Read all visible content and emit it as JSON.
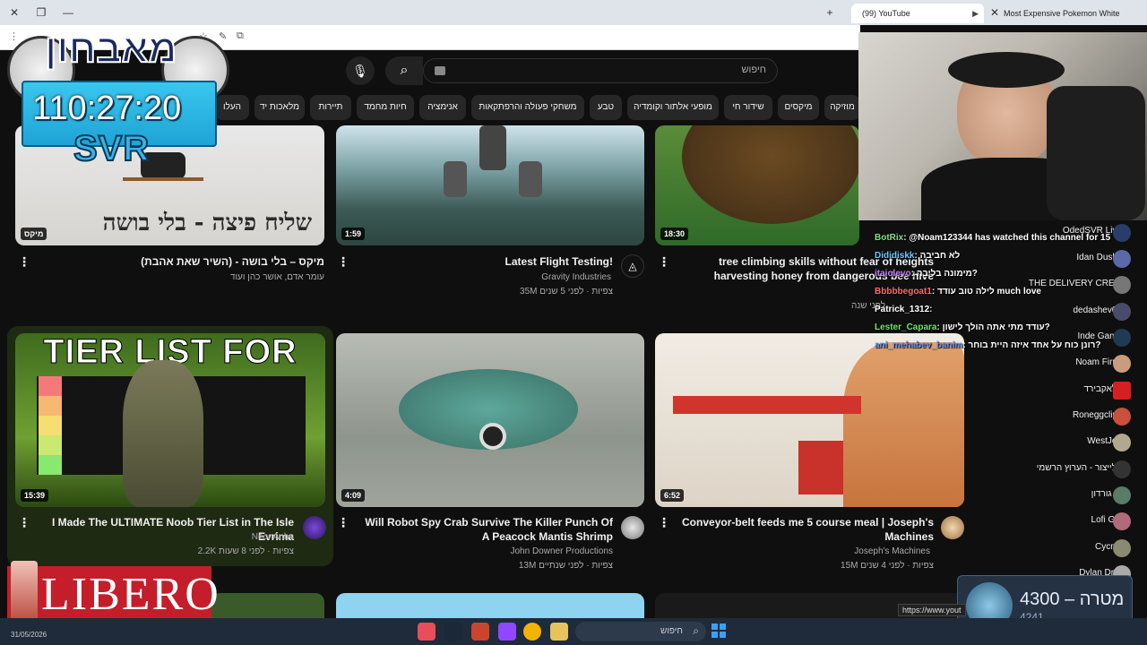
{
  "browser": {
    "tabs": [
      {
        "label": "(99) YouTube",
        "active": true
      },
      {
        "label": "Most Expensive Pokemon White",
        "active": false
      }
    ],
    "new_tab": "+",
    "close_tab": "✕"
  },
  "youtube": {
    "search_placeholder": "חיפוש",
    "chips": [
      "מוזיקה",
      "מיקסים",
      "שידור חי",
      "מופעי אלתור וקומדיה",
      "טבע",
      "משחקי פעולה והרפתקאות",
      "אנימציה",
      "חיות מחמד",
      "תיירות",
      "מלאכות יד",
      "העלו"
    ],
    "videos": [
      {
        "title": "מיקס – בלי בושה - (השיר שאת אהבת)",
        "channel": "עומר אדם, אושר כהן ועוד",
        "meta": "",
        "duration": "מיקס",
        "thumb_text": "שליח פיצה - בלי בושה"
      },
      {
        "title": "Latest Flight Testing!",
        "channel": "Gravity Industries",
        "meta": "35M צפיות · לפני 5 שנים",
        "duration": "1:59"
      },
      {
        "title": "tree climbing skills without fear of heights harvesting honey from dangerous bee hive",
        "channel": "",
        "meta": "לפני שנה",
        "duration": "18:30"
      },
      {
        "title": "I Made The ULTIMATE Noob Tier List in The Isle Evrima",
        "channel": "NeonAnbu",
        "meta": "2.2K צפיות · לפני 8 שעות",
        "duration": "15:39",
        "thumb_text": "TIER LIST FOR NOOBS"
      },
      {
        "title": "Will Robot Spy Crab Survive The Killer Punch Of A Peacock Mantis Shrimp",
        "channel": "John Downer Productions",
        "meta": "13M צפיות · לפני שנתיים",
        "duration": "4:09"
      },
      {
        "title": "Conveyor-belt feeds me 5 course meal | Joseph's Machines",
        "channel": "Joseph's Machines",
        "meta": "15M צפיות · לפני 4 שנים",
        "duration": "6:52"
      }
    ]
  },
  "stream_overlay": {
    "logo": "מאבחון",
    "timer": "110:27:20",
    "svr": "SVR",
    "sponsor": "LIBERO",
    "goal_label": "4300 – מטרה",
    "goal_progress": "4241",
    "chat_messages": [
      {
        "user": "BotRix",
        "text": "@Noam123344 has watched this channel for 15",
        "color": "#7fe07f"
      },
      {
        "user": "Dididiskk",
        "text": "לא חביבה",
        "color": "#67c8ff"
      },
      {
        "user": "itaiolevo",
        "text": "מימונה בליבה?",
        "color": "#c080ff"
      },
      {
        "user": "Bbbbbegoat1",
        "text": "לילה טוב עודד much love",
        "color": "#ff6a6a"
      },
      {
        "user": "Patrick_1312",
        "text": "",
        "color": "#ffffff"
      },
      {
        "user": "Lester_Capara",
        "text": "עודד מתי אתה הולך לישון?",
        "color": "#6fe36f"
      },
      {
        "user": "ani_mehabev_banim",
        "text": "רונן כוח על אחד איזה היית בוחר?",
        "color": "#5b8cff"
      }
    ],
    "viewers": [
      "OdedSVR Live",
      "Idan Dushy",
      "THE DELIVERY CRE...",
      "dedashev02",
      "Inde Game",
      "Noam Firuz",
      "בלאקבירד",
      "Roneggclips",
      "WestJett",
      "אלייצור - הערוץ הרשמי",
      "בן גורדון",
      "Lofi Girl",
      "Cycnic",
      "Dylan Dror"
    ]
  },
  "taskbar": {
    "search_placeholder": "חיפוש",
    "date": "31/05/2026"
  },
  "status_url": "https://www.yout"
}
